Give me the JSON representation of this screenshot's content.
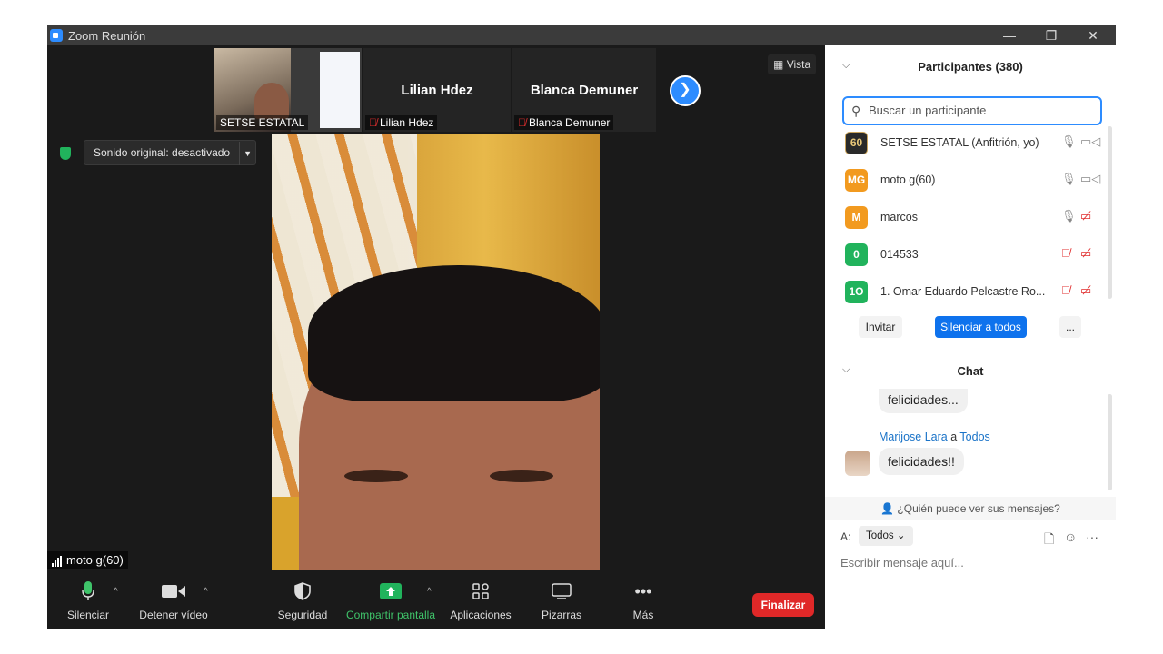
{
  "window": {
    "title": "Zoom Reunión",
    "controls": {
      "minimize": "—",
      "restore": "❐",
      "close": "✕"
    }
  },
  "video": {
    "view_label": "Vista",
    "thumbnails": [
      {
        "label": "SETSE ESTATAL",
        "name": ""
      },
      {
        "label": "Lilian Hdez",
        "name": "Lilian Hdez"
      },
      {
        "label": "Blanca Demuner",
        "name": "Blanca Demuner"
      }
    ],
    "original_sound": "Sonido original: desactivado",
    "active_speaker": "moto g(60)"
  },
  "toolbar": {
    "mute": "Silenciar",
    "stop_video": "Detener vídeo",
    "security": "Seguridad",
    "share_screen": "Compartir pantalla",
    "apps": "Aplicaciones",
    "whiteboards": "Pizarras",
    "more": "Más",
    "end": "Finalizar"
  },
  "participants": {
    "header": "Participantes (380)",
    "search_placeholder": "Buscar un participante",
    "list": [
      {
        "avatar": "60",
        "name": "SETSE ESTATAL (Anfitrión, yo)",
        "avatar_color": "#2a2a2a",
        "mic_muted": false,
        "cam_off": false
      },
      {
        "avatar": "MG",
        "name": "moto g(60)",
        "avatar_color": "#f29a1f",
        "mic_muted": false,
        "cam_off": false
      },
      {
        "avatar": "M",
        "name": "marcos",
        "avatar_color": "#f29a1f",
        "mic_muted": false,
        "cam_off": true
      },
      {
        "avatar": "0",
        "name": "014533",
        "avatar_color": "#21b35c",
        "mic_muted": true,
        "cam_off": true
      },
      {
        "avatar": "1O",
        "name": "1. Omar Eduardo Pelcastre Ro...",
        "avatar_color": "#21b35c",
        "mic_muted": true,
        "cam_off": true
      }
    ],
    "invite": "Invitar",
    "mute_all": "Silenciar a todos",
    "more": "..."
  },
  "chat": {
    "header": "Chat",
    "messages": [
      {
        "text": "felicidades..."
      },
      {
        "sender": "Marijose Lara",
        "connector": "a",
        "recipient": "Todos",
        "text": "felicidades!!"
      }
    ],
    "who_can_see": "¿Quién puede ver sus mensajes?",
    "to_label": "A:",
    "to_value": "Todos",
    "input_placeholder": "Escribir mensaje aquí..."
  },
  "colors": {
    "accent": "#2d8cff",
    "end": "#e02828",
    "share": "#21b35c"
  }
}
